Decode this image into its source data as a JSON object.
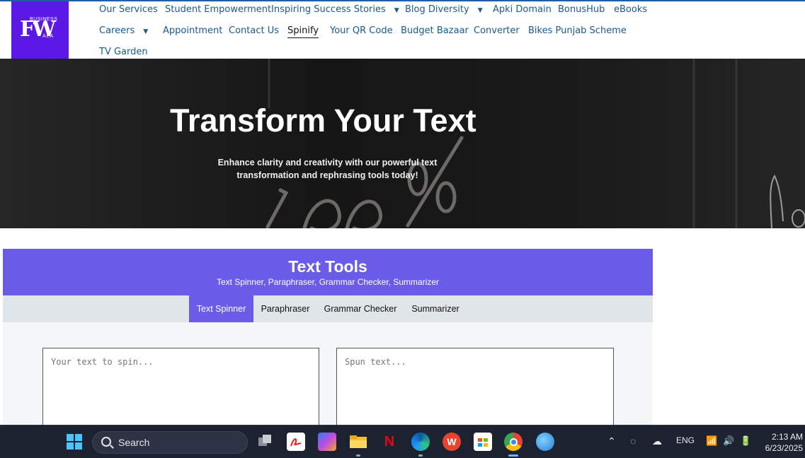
{
  "nav": {
    "items": [
      {
        "label": "Our Services"
      },
      {
        "label": "Student Empowerment"
      },
      {
        "label": "Inspiring Success Stories"
      },
      {
        "label": "Blog Diversity"
      },
      {
        "label": "Apki Domain"
      },
      {
        "label": "BonusHub"
      },
      {
        "label": "eBooks"
      },
      {
        "label": "Careers"
      },
      {
        "label": "Appointment"
      },
      {
        "label": "Contact Us"
      },
      {
        "label": "Spinify"
      },
      {
        "label": "Your QR Code"
      },
      {
        "label": "Budget Bazaar"
      },
      {
        "label": "Converter"
      },
      {
        "label": "Bikes Punjab Scheme"
      },
      {
        "label": "TV Garden"
      }
    ],
    "active": "Spinify"
  },
  "logo": {
    "text_big": "FW",
    "text_top": "BUSINESS",
    "text_bottom": "ALA",
    "bg": "#5b19e6"
  },
  "hero": {
    "title": "Transform Your Text",
    "subtitle": "Enhance clarity and creativity with our powerful text transformation and rephrasing tools today!"
  },
  "tools": {
    "title": "Text Tools",
    "subtitle": "Text Spinner, Paraphraser, Grammar Checker, Summarizer",
    "accent": "#6b5ce7",
    "tabs": [
      {
        "label": "Text Spinner"
      },
      {
        "label": "Paraphraser"
      },
      {
        "label": "Grammar Checker"
      },
      {
        "label": "Summarizer"
      }
    ],
    "active_tab": "Text Spinner",
    "input_placeholder": "Your text to spin...",
    "output_placeholder": "Spun text..."
  },
  "taskbar": {
    "search_label": "Search",
    "language": "ENG",
    "time": "2:13 AM",
    "date": "6/23/2025",
    "icons": [
      "windows-start-icon",
      "search-icon",
      "task-view-icon",
      "pdf-icon",
      "copilot-icon",
      "file-explorer-icon",
      "netflix-icon",
      "edge-icon",
      "wps-icon",
      "store-icon",
      "chrome-icon",
      "paint-icon"
    ],
    "netflix_glyph": "N",
    "wps_glyph": "W"
  }
}
